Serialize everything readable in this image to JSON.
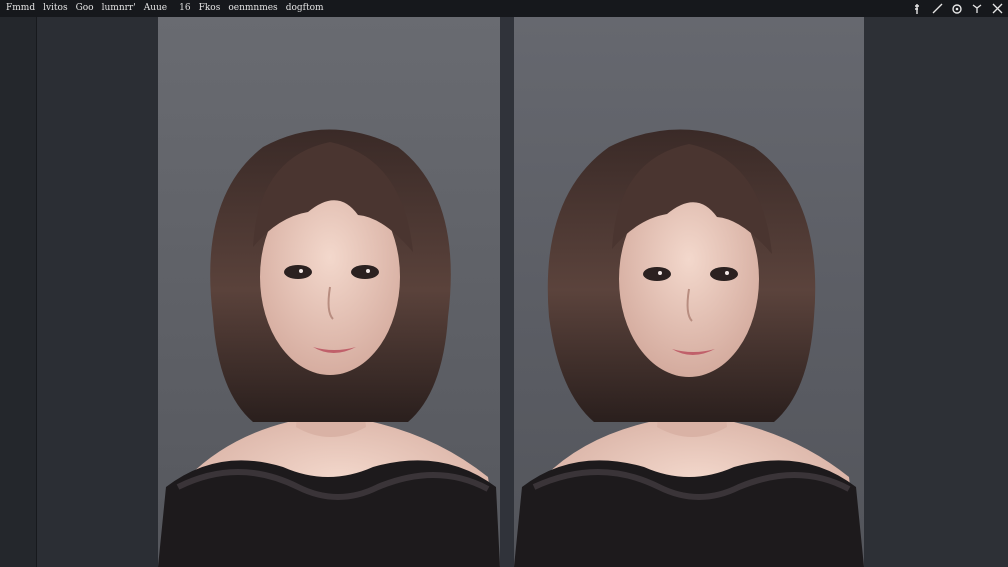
{
  "menubar": {
    "items": [
      {
        "label": "Fmmd"
      },
      {
        "label": "lvitos"
      },
      {
        "label": "Goo"
      },
      {
        "label": "lumnrr'"
      },
      {
        "label": "Auue"
      },
      {
        "label": "16"
      },
      {
        "label": "Fkos"
      },
      {
        "label": "oenmnmes"
      },
      {
        "label": "dogftom"
      }
    ],
    "tools": [
      {
        "icon": "pin-icon"
      },
      {
        "icon": "pen-icon"
      },
      {
        "icon": "settings-icon"
      },
      {
        "icon": "chevron-down-icon"
      },
      {
        "icon": "close-icon"
      }
    ]
  },
  "canvas": {
    "panels": [
      {
        "name": "left-image"
      },
      {
        "name": "right-image"
      }
    ],
    "colors": {
      "background": "#2a2d33",
      "menubar": "#16181c",
      "frame": "#64666c",
      "hair": "#4a3530",
      "skin": "#e8c9bd",
      "dress": "#1d1a1c"
    }
  }
}
